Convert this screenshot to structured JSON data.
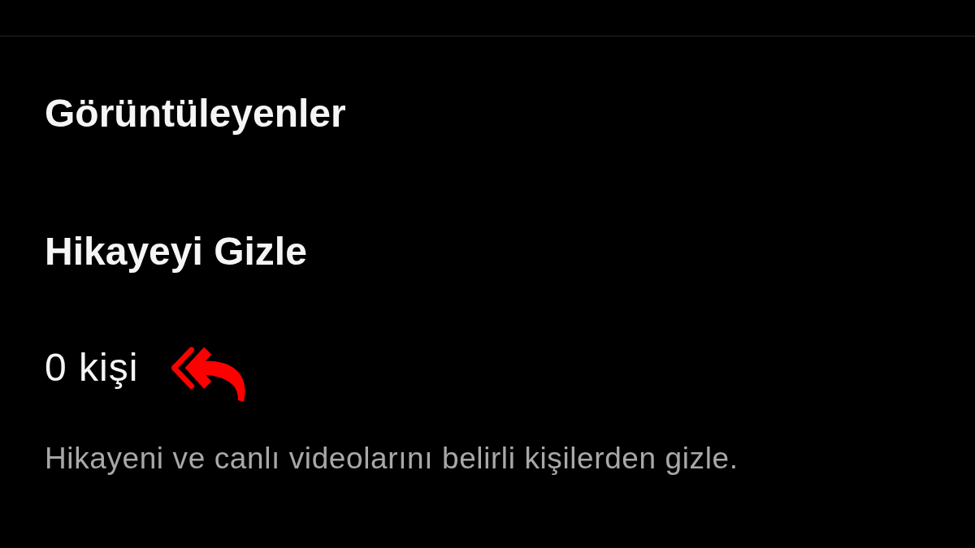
{
  "menu_items": [
    {
      "label": "Görüntüleyenler"
    }
  ],
  "hide_story": {
    "title": "Hikayeyi Gizle",
    "count": "0 kişi",
    "description": "Hikayeni ve canlı videolarını belirli kişilerden gizle."
  }
}
